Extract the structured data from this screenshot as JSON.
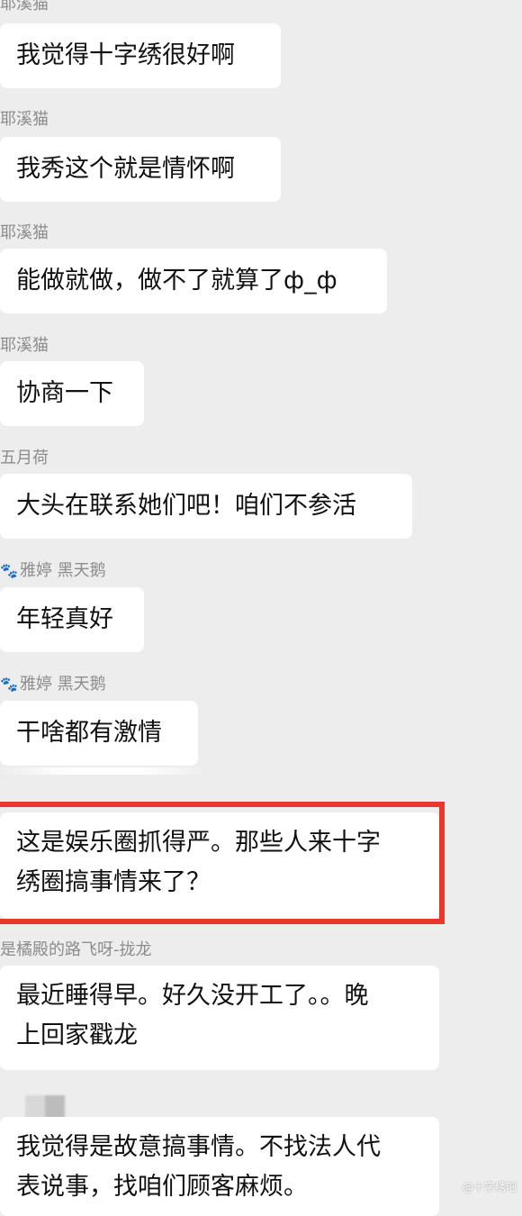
{
  "messages": [
    {
      "sender": "耶溪猫",
      "text": "我觉得十字绣很好啊"
    },
    {
      "sender": "耶溪猫",
      "text": "我秀这个就是情怀啊"
    },
    {
      "sender": "耶溪猫",
      "text": "能做就做，做不了就算了ф_ф"
    },
    {
      "sender": "耶溪猫",
      "text": "协商一下"
    },
    {
      "sender": "五月荷",
      "text": "大头在联系她们吧！咱们不参活"
    },
    {
      "sender": "雅婷 黑天鹅",
      "text": "年轻真好"
    },
    {
      "sender": "雅婷 黑天鹅",
      "text": "干啥都有激情"
    },
    {
      "sender": "",
      "text_lines": [
        "这是娱乐圈抓得严。那些人来十字",
        "绣圈搞事情来了？"
      ]
    },
    {
      "sender": "是橘殿的路飞呀-拢龙",
      "text_lines": [
        "最近睡得早。好久没开工了。。晚",
        "上回家戳龙"
      ]
    },
    {
      "sender": "",
      "text_lines": [
        "我觉得是故意搞事情。不找法人代",
        "表说事，找咱们顾客麻烦。"
      ]
    }
  ],
  "watermark": "@十字绣吧",
  "colors": {
    "background": "#ededed",
    "bubble": "#ffffff",
    "highlight": "#e8382c"
  }
}
